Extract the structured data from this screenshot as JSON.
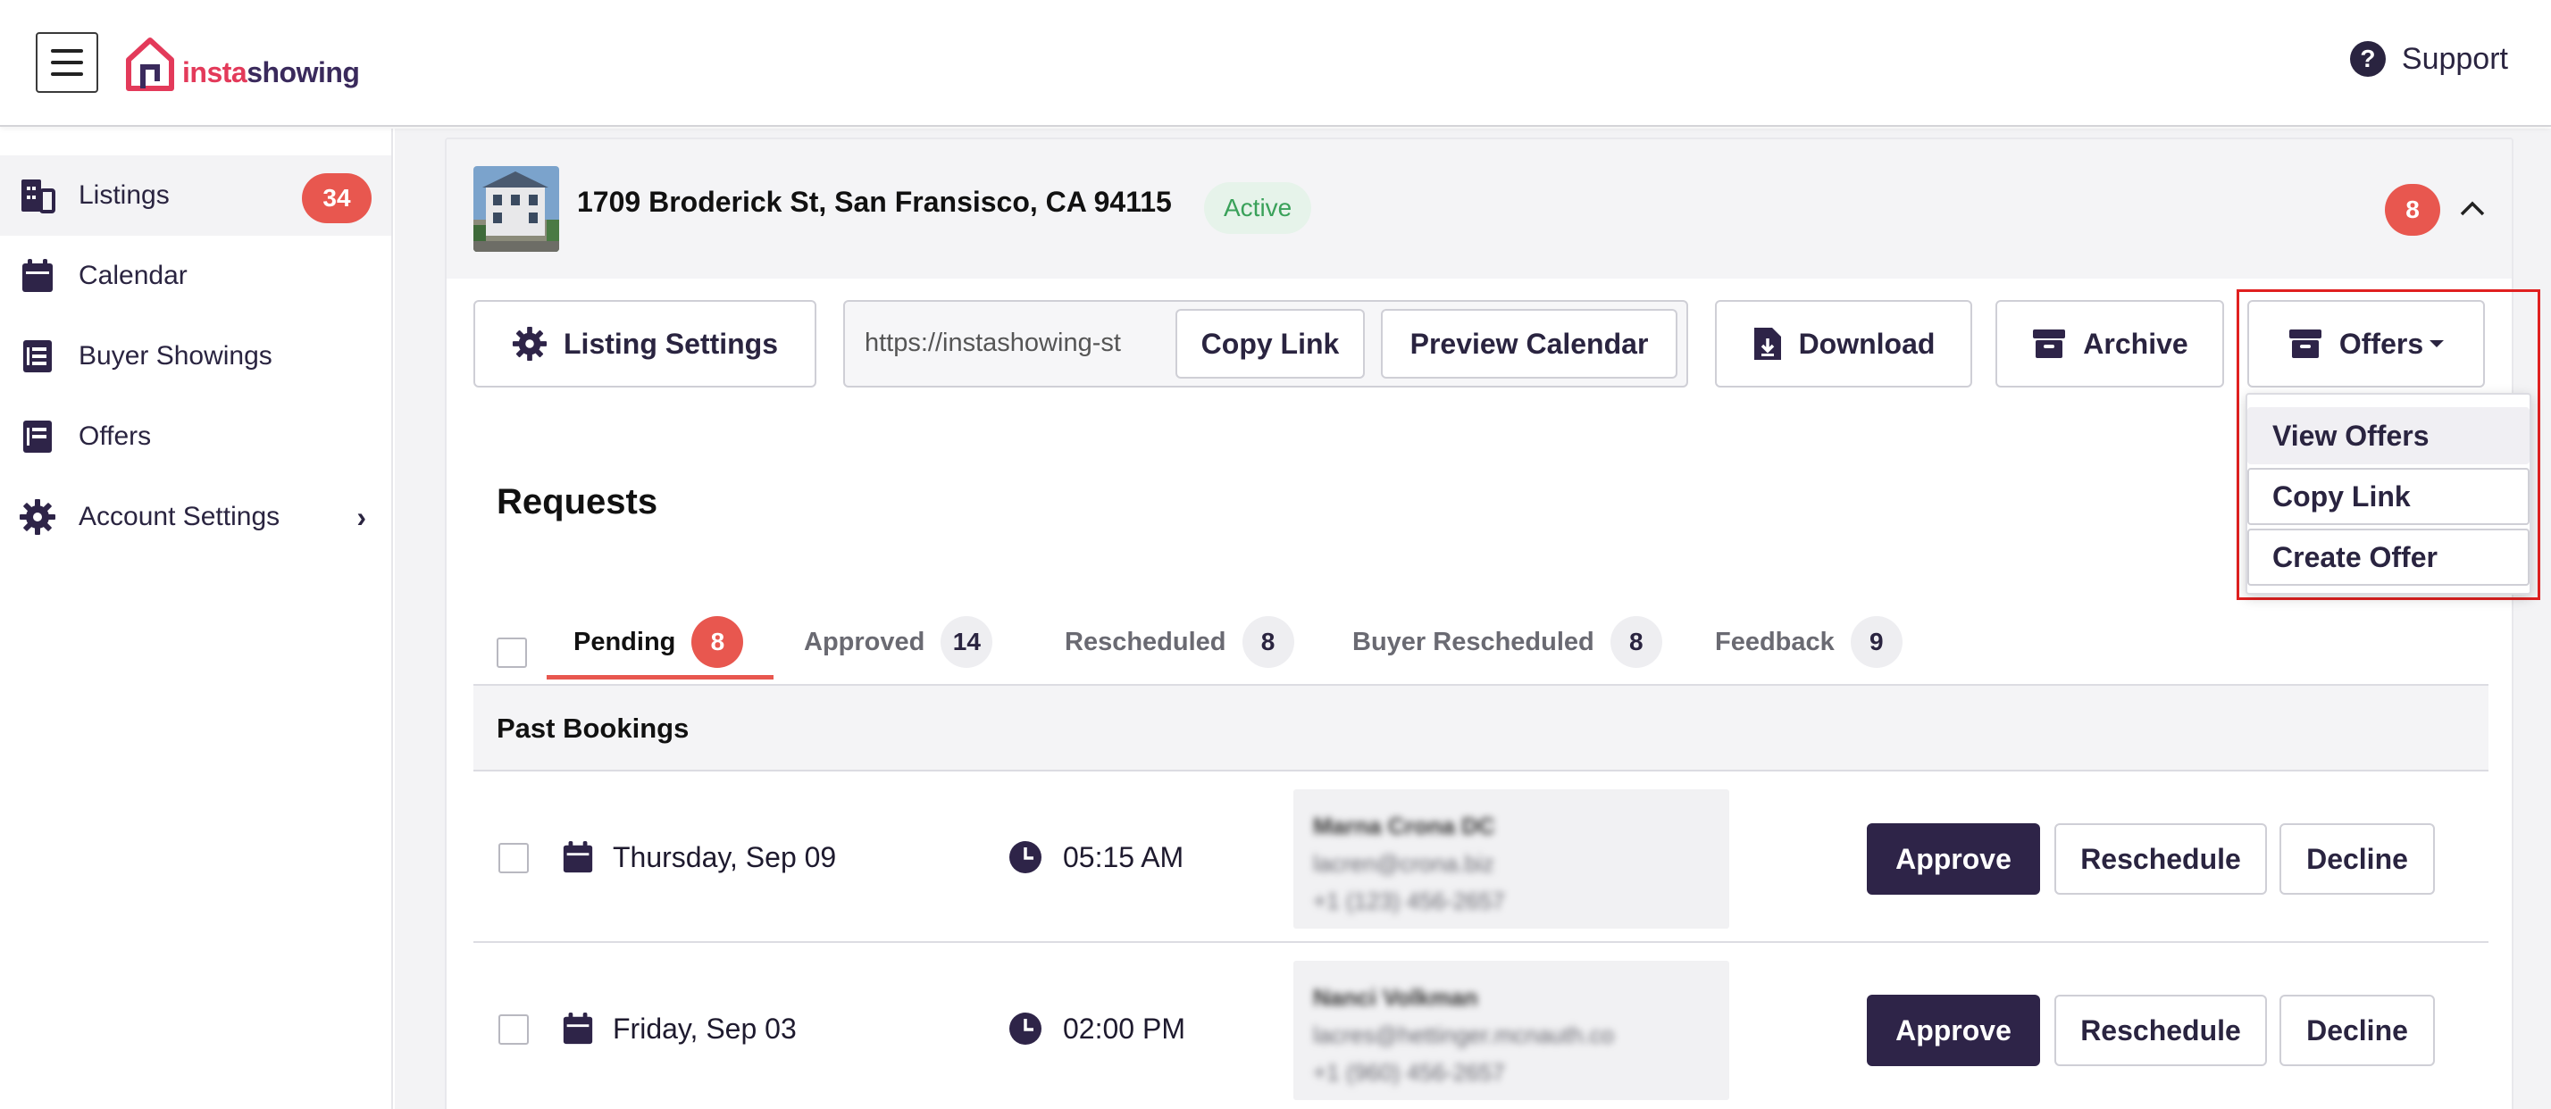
{
  "header": {
    "logo_part1": "insta",
    "logo_part2": "showing",
    "support_label": "Support",
    "help_icon": "question-circle-icon"
  },
  "sidebar": {
    "items": [
      {
        "label": "Listings",
        "icon": "building-icon",
        "badge": "34",
        "active": true
      },
      {
        "label": "Calendar",
        "icon": "calendar-icon"
      },
      {
        "label": "Buyer Showings",
        "icon": "list-icon"
      },
      {
        "label": "Offers",
        "icon": "document-icon"
      },
      {
        "label": "Account Settings",
        "icon": "gear-icon",
        "chevron": "›"
      }
    ]
  },
  "listing": {
    "address": "1709 Broderick St, San Fransisco, CA 94115",
    "status": "Active",
    "badge": "8",
    "collapse_icon": "chevron-up-icon"
  },
  "toolbar": {
    "listing_settings": "Listing Settings",
    "url_value": "https://instashowing-st",
    "copy_link": "Copy Link",
    "preview_calendar": "Preview Calendar",
    "download": "Download",
    "archive": "Archive",
    "offers": "Offers"
  },
  "offers_menu": {
    "items": [
      "View Offers",
      "Copy Link",
      "Create Offer"
    ]
  },
  "requests": {
    "title": "Requests",
    "tabs": [
      {
        "label": "Pending",
        "count": "8",
        "active": true
      },
      {
        "label": "Approved",
        "count": "14"
      },
      {
        "label": "Rescheduled",
        "count": "8"
      },
      {
        "label": "Buyer Rescheduled",
        "count": "8"
      },
      {
        "label": "Feedback",
        "count": "9"
      }
    ],
    "section_label": "Past Bookings",
    "rows": [
      {
        "date": "Thursday, Sep 09",
        "time": "05:15 AM",
        "contact_name": "Marna Crona DC",
        "contact_email": "lacren@crona.biz",
        "contact_phone": "+1 (123) 456-2657",
        "approve": "Approve",
        "reschedule": "Reschedule",
        "decline": "Decline"
      },
      {
        "date": "Friday, Sep 03",
        "time": "02:00 PM",
        "contact_name": "Nanci Volkman",
        "contact_email": "lacres@hettinger.mcnauth.co",
        "contact_phone": "+1 (960) 456-2657",
        "approve": "Approve",
        "reschedule": "Reschedule",
        "decline": "Decline"
      }
    ]
  },
  "colors": {
    "brand_primary": "#2e2448",
    "brand_red": "#e33a5a",
    "badge_red": "#e8574f",
    "active_green": "#3aa15a",
    "highlight_red": "#e02020"
  }
}
